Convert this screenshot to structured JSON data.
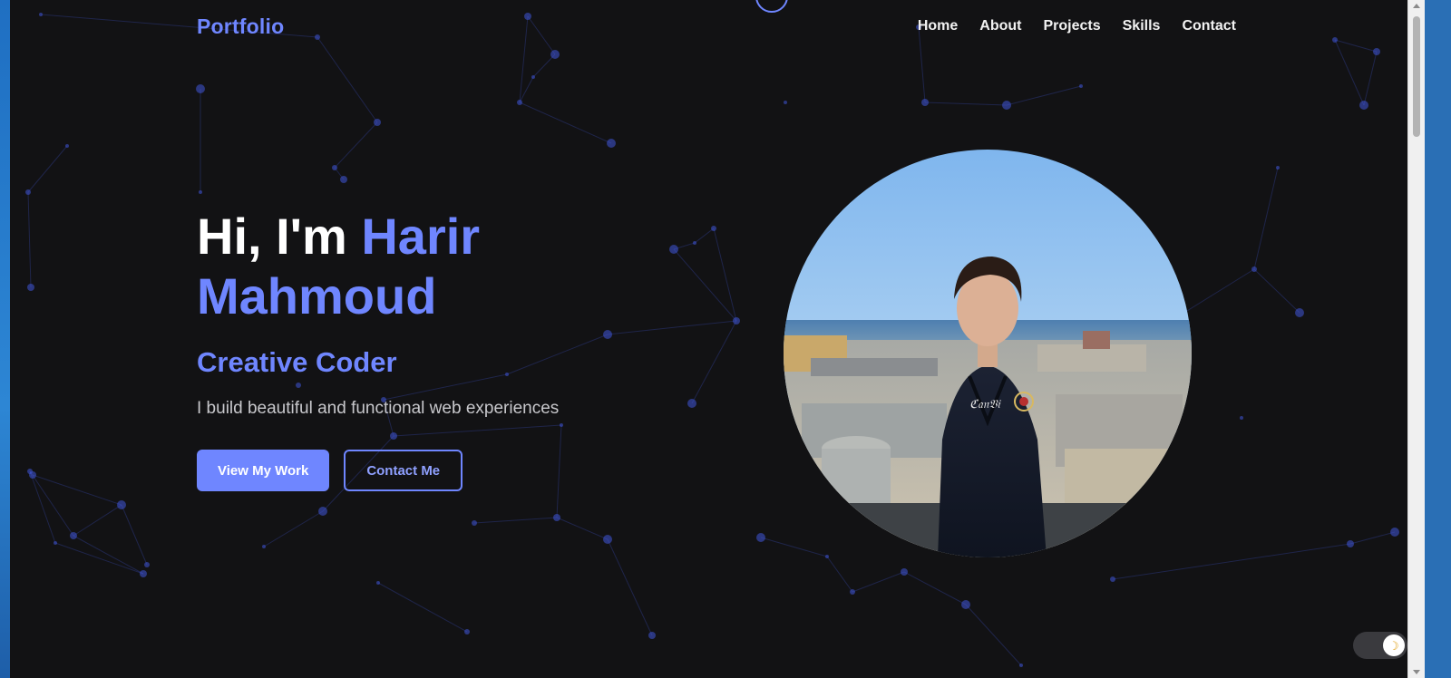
{
  "nav": {
    "logo": "Portfolio",
    "links": [
      "Home",
      "About",
      "Projects",
      "Skills",
      "Contact"
    ]
  },
  "hero": {
    "greeting": "Hi, I'm",
    "name_part1": "Harir",
    "name_part2": "Mahmoud",
    "subtitle": "Creative Coder",
    "description": "I build beautiful and functional web experiences",
    "primary_button": "View My Work",
    "secondary_button": "Contact Me"
  },
  "theme_toggle": {
    "icon": "moon-icon",
    "glyph": "☽"
  },
  "colors": {
    "background": "#121214",
    "accent": "#6f86ff",
    "text": "#ffffff",
    "muted_text": "#c8c8cc",
    "particle": "#3f56d8"
  }
}
